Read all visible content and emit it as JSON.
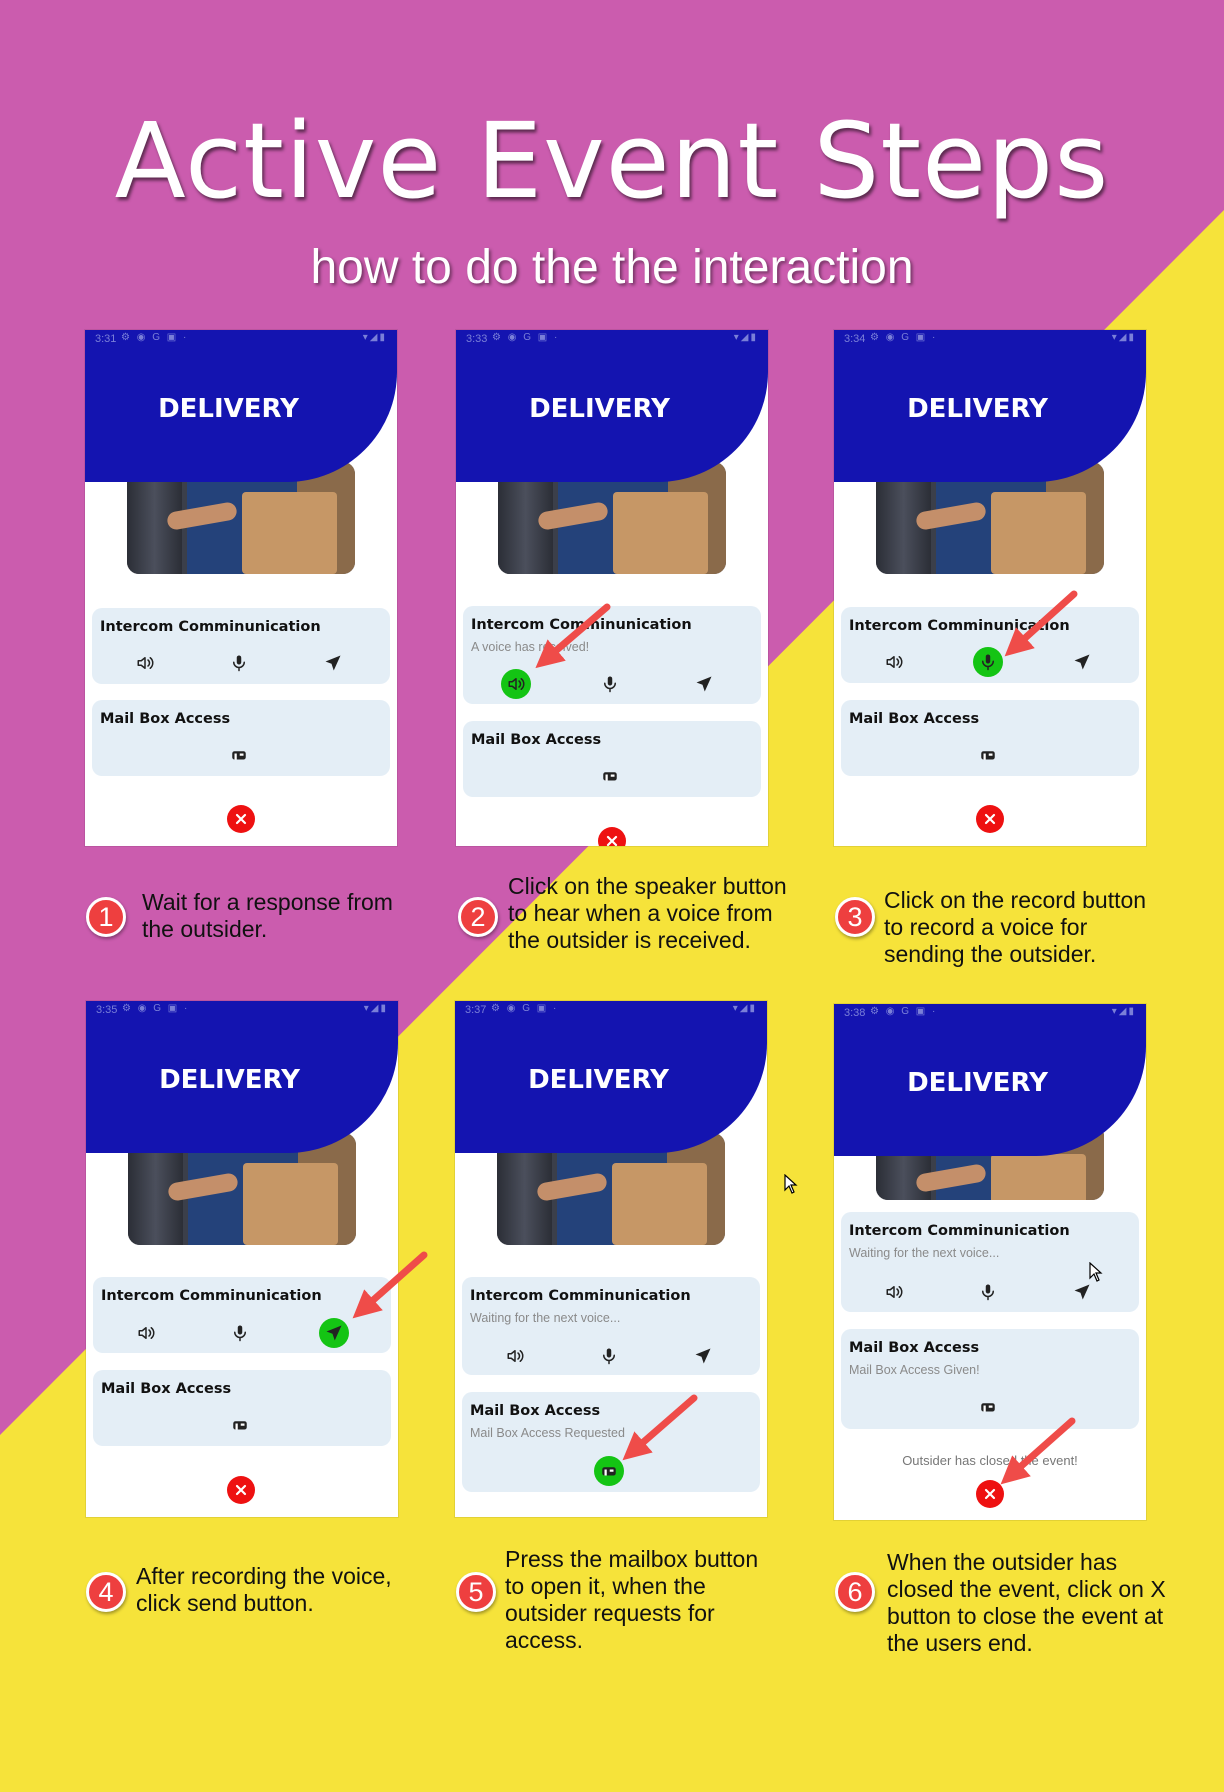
{
  "title": "Active Event Steps",
  "subtitle": "how to do the the interaction",
  "colors": {
    "magenta": "#cb5cae",
    "yellow": "#f6e33a",
    "header_blue": "#1414b0",
    "card_bg": "#e4eef6",
    "active_green": "#14c414",
    "close_red": "#ee1111",
    "badge_red": "#ee3f3f",
    "arrow_red": "#ef4c49"
  },
  "app": {
    "header_title": "DELIVERY",
    "intercom_title": "Intercom Comminunication",
    "mailbox_title": "Mail Box Access",
    "icons": [
      "speaker-icon",
      "microphone-icon",
      "send-icon",
      "mailbox-icon",
      "close-icon"
    ]
  },
  "screens": [
    {
      "time": "3:31",
      "intercom_status": "",
      "mailbox_status": "",
      "footer_note": "",
      "active_button": "none"
    },
    {
      "time": "3:33",
      "intercom_status": "A voice has received!",
      "mailbox_status": "",
      "footer_note": "",
      "active_button": "speaker"
    },
    {
      "time": "3:34",
      "intercom_status": "",
      "mailbox_status": "",
      "footer_note": "",
      "active_button": "microphone"
    },
    {
      "time": "3:35",
      "intercom_status": "",
      "mailbox_status": "",
      "footer_note": "",
      "active_button": "send"
    },
    {
      "time": "3:37",
      "intercom_status": "Waiting for the next voice...",
      "mailbox_status": "Mail Box Access Requested",
      "footer_note": "",
      "active_button": "mailbox"
    },
    {
      "time": "3:38",
      "intercom_status": "Waiting for the next voice...",
      "mailbox_status": "Mail Box Access Given!",
      "footer_note": "Outsider has closed the event!",
      "active_button": "close"
    }
  ],
  "steps": [
    {
      "number": "1",
      "text": "Wait for a response from the outsider."
    },
    {
      "number": "2",
      "text": "Click on the speaker button to hear when a voice from the outsider is received."
    },
    {
      "number": "3",
      "text": "Click on the record button to record a voice for sending the outsider."
    },
    {
      "number": "4",
      "text": "After recording the voice, click send button."
    },
    {
      "number": "5",
      "text": "Press the mailbox button to open it, when the outsider requests for access."
    },
    {
      "number": "6",
      "text": "When the outsider has closed the event, click on X button to close the event at the users end."
    }
  ]
}
